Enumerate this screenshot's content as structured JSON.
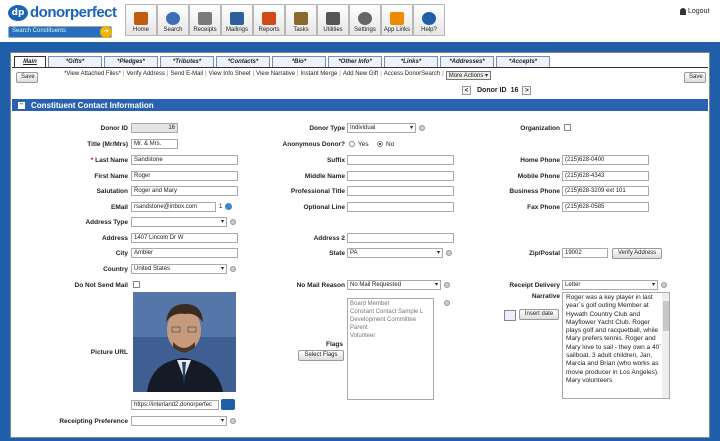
{
  "brand": {
    "logo_mark": "dp",
    "logo_text": "donorperfect",
    "search_placeholder": "Search Constituents"
  },
  "toolbar": [
    {
      "label": "Home",
      "icon": "home-icon",
      "color": "#c25a10"
    },
    {
      "label": "Search",
      "icon": "magnifier-icon",
      "color": "#3d6fb6"
    },
    {
      "label": "Receipts",
      "icon": "receipt-icon",
      "color": "#7a7a7a"
    },
    {
      "label": "Mailings",
      "icon": "mailings-icon",
      "color": "#2f5f9c"
    },
    {
      "label": "Reports",
      "icon": "bar-chart-icon",
      "color": "#d04a1a"
    },
    {
      "label": "Tasks",
      "icon": "tasks-icon",
      "color": "#8a6a2a"
    },
    {
      "label": "Utilities",
      "icon": "tools-icon",
      "color": "#555555"
    },
    {
      "label": "Settings",
      "icon": "gear-icon",
      "color": "#666666"
    },
    {
      "label": "App Links",
      "icon": "puzzle-icon",
      "color": "#f08a00"
    },
    {
      "label": "Help?",
      "icon": "help-icon",
      "color": "#1f5ea8"
    }
  ],
  "logout": "Logout",
  "tabs": [
    "Main",
    "*Gifts*",
    "*Pledges*",
    "*Tributes*",
    "*Contacts*",
    "*Bio*",
    "*Other Info*",
    "*Links*",
    "*Addresses*",
    "*Accepts*"
  ],
  "save": "Save",
  "actions": [
    "*View Attached Files*",
    "Verify Address",
    "Send E-Mail",
    "View Info Sheet",
    "View Narrative",
    "Instant Merge",
    "Add New Gift",
    "Access DonorSearch"
  ],
  "more_actions": "More Actions",
  "donor_nav": {
    "label": "Donor ID",
    "value": "16",
    "prev": "<",
    "next": ">"
  },
  "section_title": "Constituent Contact Information",
  "col1": {
    "donor_id": {
      "label": "Donor ID",
      "value": "16"
    },
    "title": {
      "label": "Title (Mr/Mrs)",
      "value": "Mr. & Mrs."
    },
    "last_name": {
      "label": "* Last Name",
      "value": "Sandstone"
    },
    "first_name": {
      "label": "First Name",
      "value": "Roger"
    },
    "salutation": {
      "label": "Salutation",
      "value": "Roger and Mary"
    },
    "email": {
      "label": "EMail",
      "value": "rsandstone@inbox.com",
      "count": "1"
    },
    "address_type": {
      "label": "Address Type",
      "value": ""
    },
    "address": {
      "label": "Address",
      "value": "1407 Lincoln Dr W"
    },
    "city": {
      "label": "City",
      "value": "Ambler"
    },
    "country": {
      "label": "Country",
      "value": "United States"
    },
    "no_mail": {
      "label": "Do Not Send Mail"
    },
    "picture_url": {
      "label": "Picture URL",
      "value": "https://interland2.donorperfec"
    },
    "receipt_pref": {
      "label": "Receipting Preference",
      "value": ""
    }
  },
  "col2": {
    "donor_type": {
      "label": "Donor Type",
      "value": "Individual"
    },
    "anonymous": {
      "label": "Anonymous Donor?",
      "yes": "Yes",
      "no": "No"
    },
    "suffix": {
      "label": "Suffix",
      "value": ""
    },
    "middle_name": {
      "label": "Middle Name",
      "value": ""
    },
    "prof_title": {
      "label": "Professional Title",
      "value": ""
    },
    "optional_line": {
      "label": "Optional Line",
      "value": ""
    },
    "address2": {
      "label": "Address 2",
      "value": ""
    },
    "state": {
      "label": "State",
      "value": "PA"
    },
    "no_mail_reason": {
      "label": "No Mail Reason",
      "value": "No Mail Requested"
    },
    "flags": {
      "label": "Flags",
      "button": "Select Flags",
      "options": [
        "Board Member",
        "Constant Contact Sample L",
        "Development Committee",
        "Parent",
        "Volunteer"
      ]
    }
  },
  "col3": {
    "organization": {
      "label": "Organization"
    },
    "home_phone": {
      "label": "Home Phone",
      "value": "(215)628-0400"
    },
    "mobile_phone": {
      "label": "Mobile Phone",
      "value": "(215)628-4343"
    },
    "business_phone": {
      "label": "Business Phone",
      "value": "(215)628-3209 ext 101"
    },
    "fax_phone": {
      "label": "Fax Phone",
      "value": "(215)628-0585"
    },
    "zip": {
      "label": "Zip/Postal",
      "value": "19002",
      "button": "Verify Address"
    },
    "receipt_delivery": {
      "label": "Receipt Delivery",
      "value": "Letter"
    },
    "narrative": {
      "label": "Narrative",
      "insert": "Insert date",
      "text": "Roger was a key player in last year`s golf outing Member at Hywath Country Club and Mayflower Yacht Club.  Roger plays golf and racquetball, while Mary prefers tennis.  Roger and Mary love to sail - they own a 40` sailboat.    3 adult children, Jan, Marcia and Brian (who works as movie producer in Los Angeles).  Mary volunteers"
    }
  }
}
